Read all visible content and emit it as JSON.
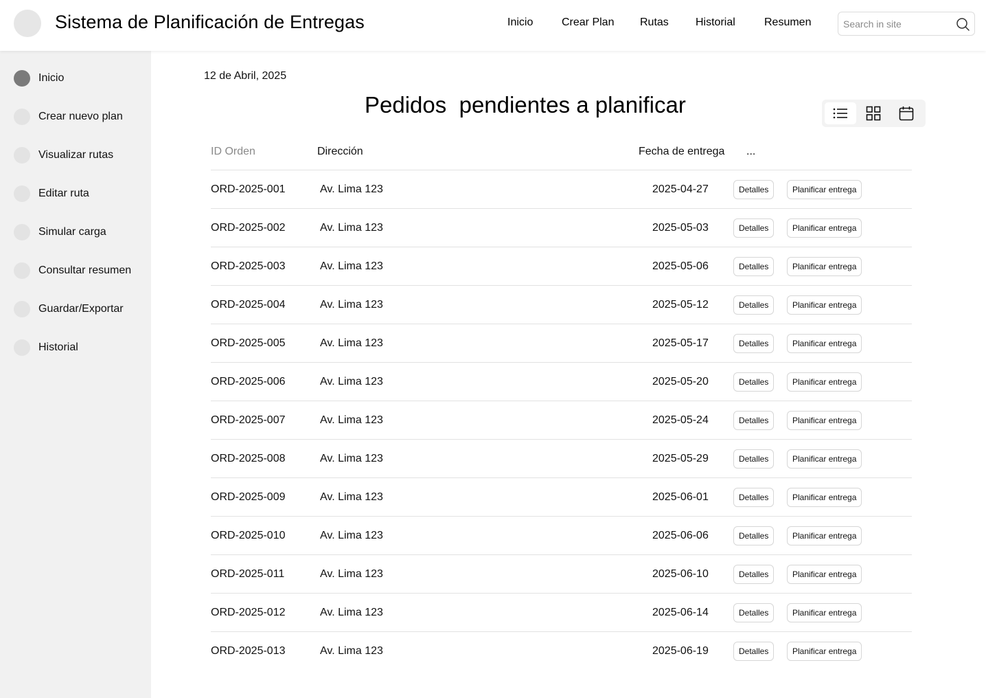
{
  "header": {
    "title": "Sistema de Planificación de Entregas",
    "nav": [
      "Inicio",
      "Crear Plan",
      "Rutas",
      "Historial",
      "Resumen"
    ],
    "search_placeholder": "Search in site"
  },
  "sidebar": {
    "items": [
      {
        "label": "Inicio",
        "active": true
      },
      {
        "label": "Crear nuevo plan",
        "active": false
      },
      {
        "label": "Visualizar rutas",
        "active": false
      },
      {
        "label": "Editar ruta",
        "active": false
      },
      {
        "label": "Simular carga",
        "active": false
      },
      {
        "label": "Consultar resumen",
        "active": false
      },
      {
        "label": "Guardar/Exportar",
        "active": false
      },
      {
        "label": "Historial",
        "active": false
      }
    ]
  },
  "main": {
    "date": "12 de Abril, 2025",
    "title": "Pedidos  pendientes a planificar",
    "view_modes": [
      "list-icon",
      "grid-icon",
      "calendar-icon"
    ],
    "active_view": "list",
    "table": {
      "headers": [
        "ID Orden",
        "Dirección",
        "Fecha de entrega",
        "..."
      ],
      "detail_label": "Detalles",
      "plan_label": "Planificar entrega",
      "rows": [
        {
          "id": "ORD-2025-001",
          "address": "Av. Lima 123",
          "date": "2025-04-27"
        },
        {
          "id": "ORD-2025-002",
          "address": "Av. Lima 123",
          "date": "2025-05-03"
        },
        {
          "id": "ORD-2025-003",
          "address": "Av. Lima 123",
          "date": "2025-05-06"
        },
        {
          "id": "ORD-2025-004",
          "address": "Av. Lima 123",
          "date": "2025-05-12"
        },
        {
          "id": "ORD-2025-005",
          "address": "Av. Lima 123",
          "date": "2025-05-17"
        },
        {
          "id": "ORD-2025-006",
          "address": "Av. Lima 123",
          "date": "2025-05-20"
        },
        {
          "id": "ORD-2025-007",
          "address": "Av. Lima 123",
          "date": "2025-05-24"
        },
        {
          "id": "ORD-2025-008",
          "address": "Av. Lima 123",
          "date": "2025-05-29"
        },
        {
          "id": "ORD-2025-009",
          "address": "Av. Lima 123",
          "date": "2025-06-01"
        },
        {
          "id": "ORD-2025-010",
          "address": "Av. Lima 123",
          "date": "2025-06-06"
        },
        {
          "id": "ORD-2025-011",
          "address": "Av. Lima 123",
          "date": "2025-06-10"
        },
        {
          "id": "ORD-2025-012",
          "address": "Av. Lima 123",
          "date": "2025-06-14"
        },
        {
          "id": "ORD-2025-013",
          "address": "Av. Lima 123",
          "date": "2025-06-19"
        }
      ]
    }
  }
}
